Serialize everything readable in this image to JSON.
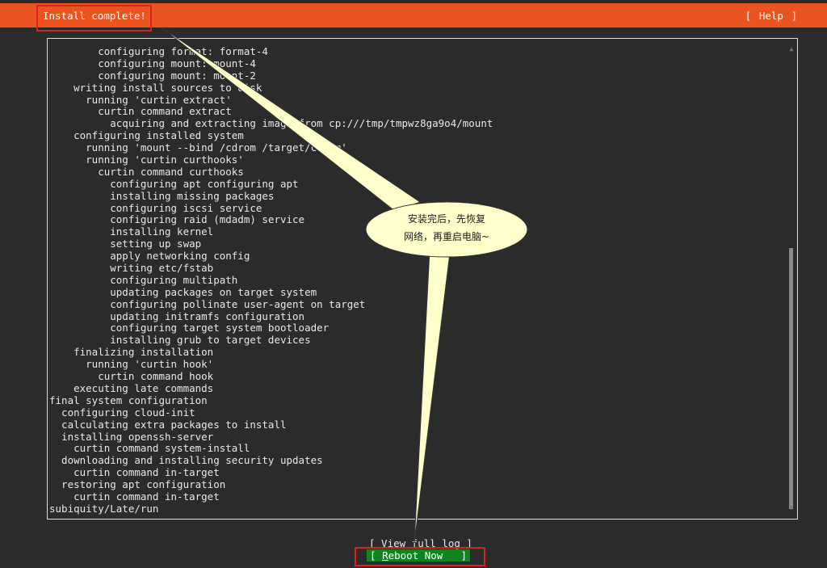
{
  "header": {
    "title": "Install complete!",
    "help_bracket_left": "[",
    "help_label": "Help",
    "help_bracket_right": "]"
  },
  "log": {
    "lines": [
      "        configuring format: format-4",
      "        configuring mount: mount-4",
      "        configuring mount: mount-2",
      "    writing install sources to disk",
      "      running 'curtin extract'",
      "        curtin command extract",
      "          acquiring and extracting image from cp:///tmp/tmpwz8ga9o4/mount",
      "    configuring installed system",
      "      running 'mount --bind /cdrom /target/cdrom'",
      "      running 'curtin curthooks'",
      "        curtin command curthooks",
      "          configuring apt configuring apt",
      "          installing missing packages",
      "          configuring iscsi service",
      "          configuring raid (mdadm) service",
      "          installing kernel",
      "          setting up swap",
      "          apply networking config",
      "          writing etc/fstab",
      "          configuring multipath",
      "          updating packages on target system",
      "          configuring pollinate user-agent on target",
      "          updating initramfs configuration",
      "          configuring target system bootloader",
      "          installing grub to target devices",
      "    finalizing installation",
      "      running 'curtin hook'",
      "        curtin command hook",
      "    executing late commands",
      "final system configuration",
      "  configuring cloud-init",
      "  calculating extra packages to install",
      "  installing openssh-server",
      "    curtin command system-install",
      "  downloading and installing security updates",
      "    curtin command in-target",
      "  restoring apt configuration",
      "    curtin command in-target",
      "subiquity/Late/run"
    ],
    "scroll_up_icon": "▲",
    "scroll_down_icon": "▼"
  },
  "buttons": {
    "view_log": "[ View full log ]",
    "reboot_open": "[ ",
    "reboot_mnemonic": "R",
    "reboot_rest": "eboot Now",
    "reboot_close": "]"
  },
  "callout": {
    "line1": "安装完后，先恢复",
    "line2": "网络，再重启电脑~"
  },
  "colors": {
    "header_bg": "#e95420",
    "button_selected_bg": "#0e8420",
    "annotation_red": "#e02020",
    "callout_fill": "#ffffcc"
  }
}
